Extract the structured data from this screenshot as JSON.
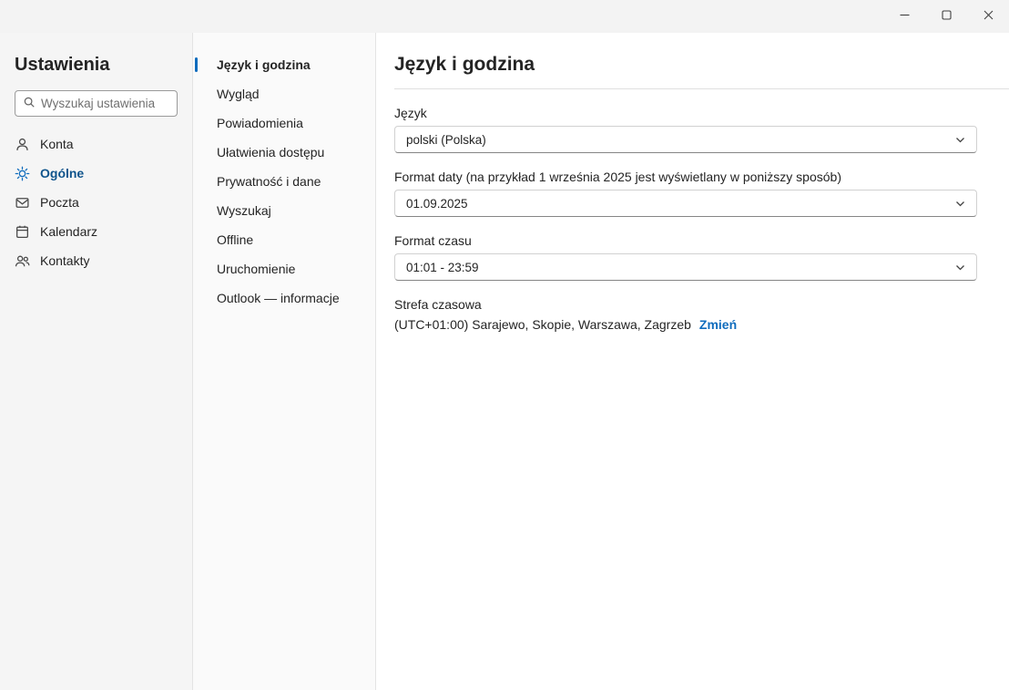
{
  "window": {
    "icons": {
      "minimize": "minimize-icon",
      "maximize": "maximize-icon",
      "close": "close-icon"
    }
  },
  "sidebar": {
    "title": "Ustawienia",
    "search": {
      "placeholder": "Wyszukaj ustawienia",
      "value": "",
      "icon": "search-icon"
    },
    "items": [
      {
        "label": "Konta",
        "icon": "person-icon",
        "selected": false
      },
      {
        "label": "Ogólne",
        "icon": "gear-icon",
        "selected": true
      },
      {
        "label": "Poczta",
        "icon": "mail-icon",
        "selected": false
      },
      {
        "label": "Kalendarz",
        "icon": "calendar-icon",
        "selected": false
      },
      {
        "label": "Kontakty",
        "icon": "people-icon",
        "selected": false
      }
    ]
  },
  "nav": {
    "items": [
      {
        "label": "Język i godzina",
        "selected": true
      },
      {
        "label": "Wygląd",
        "selected": false
      },
      {
        "label": "Powiadomienia",
        "selected": false
      },
      {
        "label": "Ułatwienia dostępu",
        "selected": false
      },
      {
        "label": "Prywatność i dane",
        "selected": false
      },
      {
        "label": "Wyszukaj",
        "selected": false
      },
      {
        "label": "Offline",
        "selected": false
      },
      {
        "label": "Uruchomienie",
        "selected": false
      },
      {
        "label": "Outlook — informacje",
        "selected": false
      }
    ]
  },
  "main": {
    "title": "Język i godzina",
    "fields": [
      {
        "label": "Język",
        "value": "polski (Polska)"
      },
      {
        "label": "Format daty (na przykład 1 września 2025 jest wyświetlany w poniższy sposób)",
        "value": "01.09.2025"
      },
      {
        "label": "Format czasu",
        "value": "01:01 - 23:59"
      }
    ],
    "timezone": {
      "label": "Strefa czasowa",
      "value": "(UTC+01:00) Sarajewo, Skopie, Warszawa, Zagrzeb",
      "change_link": "Zmień"
    }
  },
  "colors": {
    "accent": "#0f6cbd",
    "titlebar": "#f3f3f3",
    "sidebar_bg": "#f5f5f5"
  }
}
